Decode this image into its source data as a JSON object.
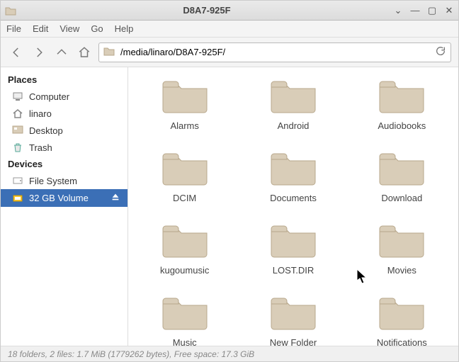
{
  "window": {
    "title": "D8A7-925F"
  },
  "menubar": {
    "file": "File",
    "edit": "Edit",
    "view": "View",
    "go": "Go",
    "help": "Help"
  },
  "toolbar": {
    "path": "/media/linaro/D8A7-925F/"
  },
  "sidebar": {
    "places_header": "Places",
    "devices_header": "Devices",
    "places": [
      {
        "label": "Computer"
      },
      {
        "label": "linaro"
      },
      {
        "label": "Desktop"
      },
      {
        "label": "Trash"
      }
    ],
    "devices": [
      {
        "label": "File System",
        "selected": false,
        "ejectable": false
      },
      {
        "label": "32 GB Volume",
        "selected": true,
        "ejectable": true
      }
    ]
  },
  "folders": [
    {
      "name": "Alarms"
    },
    {
      "name": "Android"
    },
    {
      "name": "Audiobooks"
    },
    {
      "name": "DCIM"
    },
    {
      "name": "Documents"
    },
    {
      "name": "Download"
    },
    {
      "name": "kugoumusic"
    },
    {
      "name": "LOST.DIR"
    },
    {
      "name": "Movies"
    },
    {
      "name": "Music"
    },
    {
      "name": "New Folder"
    },
    {
      "name": "Notifications"
    }
  ],
  "statusbar": {
    "text": "18 folders, 2 files: 1.7 MiB (1779262 bytes), Free space: 17.3 GiB"
  },
  "colors": {
    "selection": "#3b6fb6",
    "folder_fill": "#d9cdb8",
    "folder_stroke": "#b8a88c"
  }
}
